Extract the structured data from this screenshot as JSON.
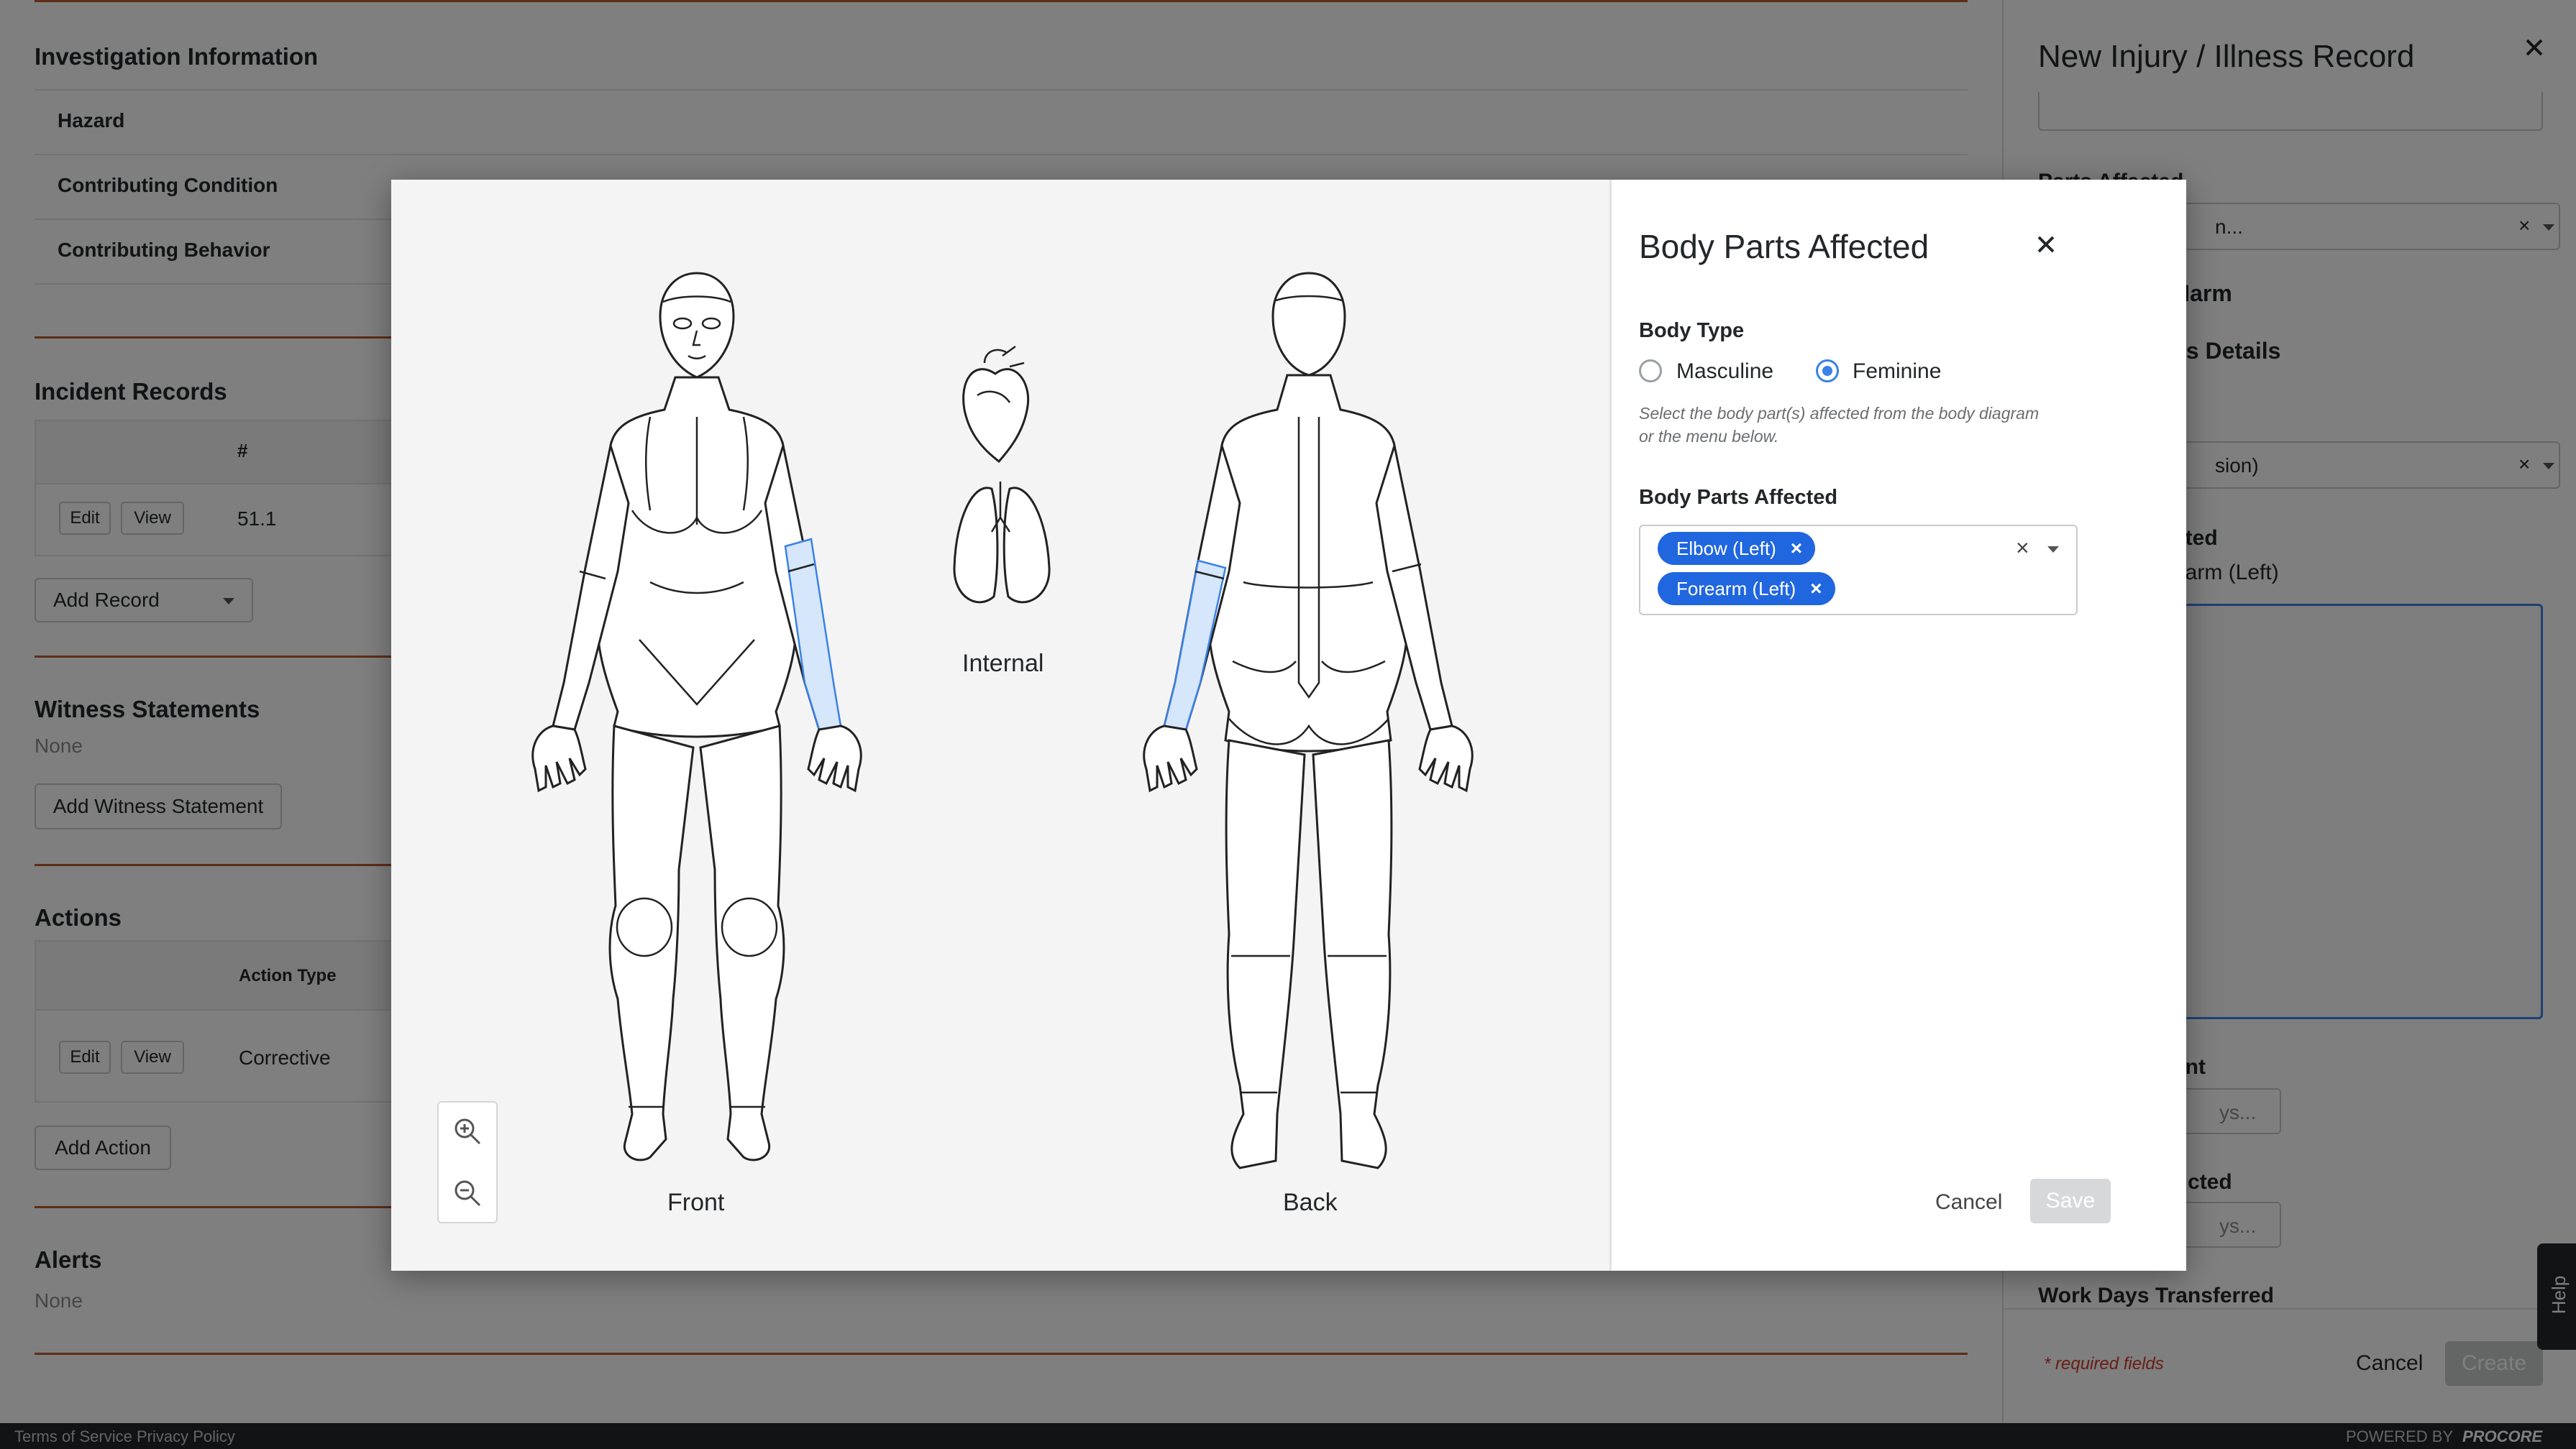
{
  "background": {
    "investigation": {
      "title": "Investigation Information",
      "rows": [
        "Hazard",
        "Contributing Condition",
        "Contributing Behavior"
      ]
    },
    "incident_records": {
      "title": "Incident Records",
      "column_hash": "#",
      "row": {
        "edit": "Edit",
        "view": "View",
        "value": "51.1"
      },
      "add_button": "Add Record"
    },
    "witness": {
      "title": "Witness Statements",
      "empty": "None",
      "add_button": "Add Witness Statement"
    },
    "actions": {
      "title": "Actions",
      "column_type": "Action Type",
      "row": {
        "edit": "Edit",
        "view": "View",
        "value": "Corrective"
      },
      "add_button": "Add Action"
    },
    "alerts": {
      "title": "Alerts",
      "empty": "None"
    }
  },
  "side_panel": {
    "title": "New Injury / Illness Record",
    "close_icon": "close-icon",
    "frag_parts_label": "Parts Affected",
    "frag_select1": "n...",
    "frag_harm": "Harm",
    "frag_details": "ss Details",
    "frag_select2": "sion)",
    "frag_affected": "cted",
    "frag_forearm": "earm (Left)",
    "frag_ent": "ent",
    "frag_days1": "ys...",
    "frag_ricted": "ricted",
    "frag_days2": "ys...",
    "work_days_transferred": "Work Days Transferred",
    "required_note": "* required fields",
    "cancel": "Cancel",
    "create": "Create",
    "help": "Help"
  },
  "footer": {
    "terms": "Terms of Service",
    "privacy": "Privacy Policy",
    "powered_by": "POWERED BY",
    "brand": "PROCORE"
  },
  "modal": {
    "title": "Body Parts Affected",
    "close_icon": "close-icon",
    "body_type_label": "Body Type",
    "options": {
      "masculine": "Masculine",
      "feminine": "Feminine"
    },
    "selected_body_type": "Feminine",
    "hint_line1": "Select the body part(s) affected from the body diagram",
    "hint_line2": "or the menu below.",
    "parts_label": "Body Parts Affected",
    "selected_parts": [
      "Elbow (Left)",
      "Forearm (Left)"
    ],
    "diagram_labels": {
      "front": "Front",
      "internal": "Internal",
      "back": "Back"
    },
    "zoom_in_icon": "zoom-in-icon",
    "zoom_out_icon": "zoom-out-icon",
    "cancel": "Cancel",
    "save": "Save"
  },
  "colors": {
    "accent": "#2066df",
    "highlight": "#d6e6fb",
    "divider_orange": "#b85c2c"
  }
}
